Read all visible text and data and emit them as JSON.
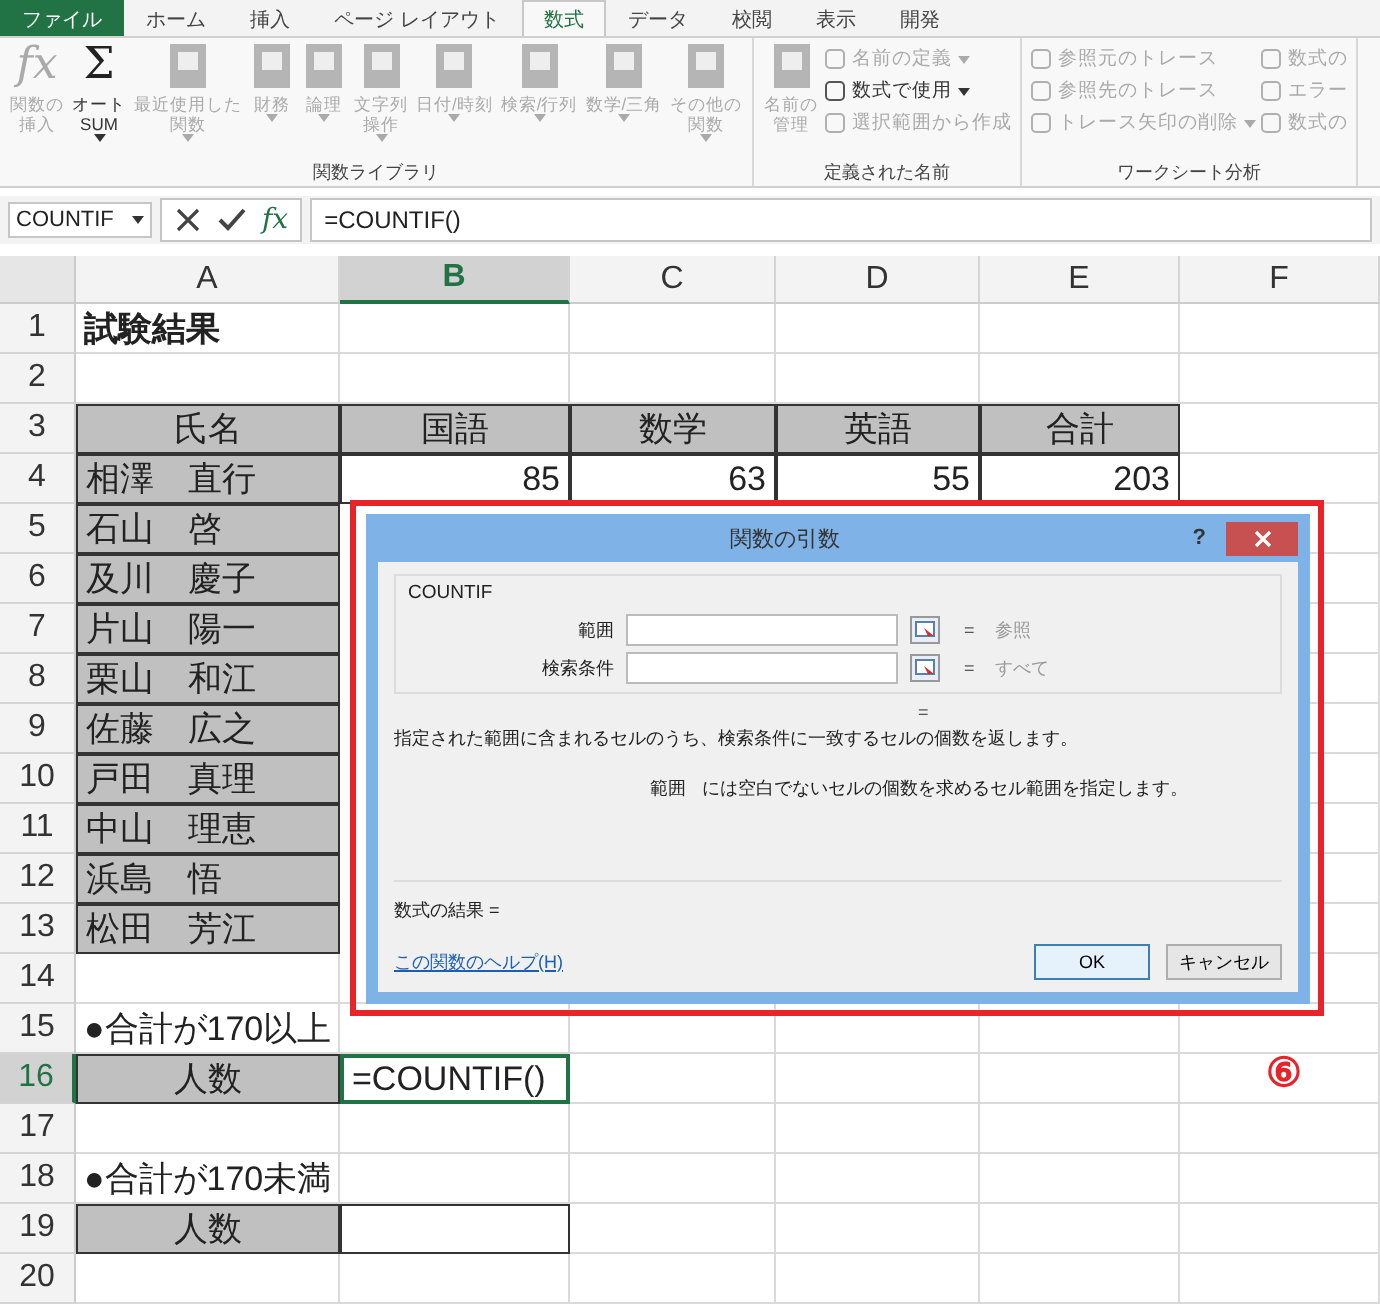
{
  "tabs": [
    {
      "label": "ファイル",
      "kind": "file",
      "selected": false
    },
    {
      "label": "ホーム",
      "kind": "tab",
      "selected": false
    },
    {
      "label": "挿入",
      "kind": "tab",
      "selected": false
    },
    {
      "label": "ページ レイアウト",
      "kind": "tab",
      "selected": false
    },
    {
      "label": "数式",
      "kind": "tab",
      "selected": true
    },
    {
      "label": "データ",
      "kind": "tab",
      "selected": false
    },
    {
      "label": "校閲",
      "kind": "tab",
      "selected": false
    },
    {
      "label": "表示",
      "kind": "tab",
      "selected": false
    },
    {
      "label": "開発",
      "kind": "tab",
      "selected": false
    }
  ],
  "ribbon": [
    {
      "label": "関数ライブラリ",
      "buttons": [
        {
          "lines": [
            "関数の",
            "挿入"
          ],
          "symbol": "fx",
          "disabled": true,
          "dropdown": false
        },
        {
          "lines": [
            "オート",
            "SUM"
          ],
          "symbol": "Σ",
          "disabled": false,
          "dropdown": true
        },
        {
          "lines": [
            "最近使用した",
            "関数"
          ],
          "disabled": true,
          "dropdown": true
        },
        {
          "lines": [
            "財務"
          ],
          "disabled": true,
          "dropdown": true
        },
        {
          "lines": [
            "論理"
          ],
          "disabled": true,
          "dropdown": true
        },
        {
          "lines": [
            "文字列",
            "操作"
          ],
          "disabled": true,
          "dropdown": true
        },
        {
          "lines": [
            "日付/時刻"
          ],
          "disabled": true,
          "dropdown": true
        },
        {
          "lines": [
            "検索/行列"
          ],
          "disabled": true,
          "dropdown": true
        },
        {
          "lines": [
            "数学/三角"
          ],
          "disabled": true,
          "dropdown": true
        },
        {
          "lines": [
            "その他の",
            "関数"
          ],
          "disabled": true,
          "dropdown": true
        }
      ]
    },
    {
      "label": "定義された名前",
      "buttons": [
        {
          "lines": [
            "名前の",
            "管理"
          ],
          "disabled": true,
          "dropdown": false
        }
      ],
      "small": [
        {
          "label": "名前の定義",
          "disabled": true,
          "dropdown": true
        },
        {
          "label": "数式で使用",
          "disabled": false,
          "dropdown": true
        },
        {
          "label": "選択範囲から作成",
          "disabled": true,
          "dropdown": false
        }
      ]
    },
    {
      "label": "ワークシート分析",
      "small": [
        {
          "label": "参照元のトレース",
          "disabled": true,
          "dropdown": false
        },
        {
          "label": "参照先のトレース",
          "disabled": true,
          "dropdown": false
        },
        {
          "label": "トレース矢印の削除",
          "disabled": true,
          "dropdown": true
        }
      ],
      "small2": [
        {
          "label": "数式の",
          "disabled": true
        },
        {
          "label": "エラー",
          "disabled": true
        },
        {
          "label": "数式の",
          "disabled": true
        }
      ]
    }
  ],
  "formula_bar": {
    "name_box": "COUNTIF",
    "fx": "fx",
    "formula": "=COUNTIF()"
  },
  "columns": [
    {
      "label": "A",
      "selected": false
    },
    {
      "label": "B",
      "selected": true
    },
    {
      "label": "C",
      "selected": false
    },
    {
      "label": "D",
      "selected": false
    },
    {
      "label": "E",
      "selected": false
    },
    {
      "label": "F",
      "selected": false
    }
  ],
  "rows": [
    {
      "number": "1",
      "selected": false,
      "cells": [
        {
          "kind": "title",
          "text": "試験結果"
        },
        {},
        {},
        {},
        {},
        {}
      ]
    },
    {
      "number": "2",
      "selected": false,
      "cells": [
        {},
        {},
        {},
        {},
        {},
        {}
      ]
    },
    {
      "number": "3",
      "selected": false,
      "cells": [
        {
          "kind": "header",
          "text": "氏名"
        },
        {
          "kind": "header",
          "text": "国語"
        },
        {
          "kind": "header",
          "text": "数学"
        },
        {
          "kind": "header",
          "text": "英語"
        },
        {
          "kind": "header",
          "text": "合計"
        },
        {}
      ]
    },
    {
      "number": "4",
      "selected": false,
      "cells": [
        {
          "kind": "name",
          "text": "相澤　直行"
        },
        {
          "kind": "number",
          "text": "85"
        },
        {
          "kind": "number",
          "text": "63"
        },
        {
          "kind": "number",
          "text": "55"
        },
        {
          "kind": "number",
          "text": "203"
        },
        {}
      ]
    },
    {
      "number": "5",
      "selected": false,
      "cells": [
        {
          "kind": "name",
          "text": "石山　啓"
        },
        {
          "kind": "number"
        },
        {
          "kind": "number"
        },
        {
          "kind": "number"
        },
        {
          "kind": "number"
        },
        {}
      ]
    },
    {
      "number": "6",
      "selected": false,
      "cells": [
        {
          "kind": "name",
          "text": "及川　慶子"
        },
        {
          "kind": "number"
        },
        {
          "kind": "number"
        },
        {
          "kind": "number"
        },
        {
          "kind": "number"
        },
        {}
      ]
    },
    {
      "number": "7",
      "selected": false,
      "cells": [
        {
          "kind": "name",
          "text": "片山　陽一"
        },
        {
          "kind": "number"
        },
        {
          "kind": "number"
        },
        {
          "kind": "number"
        },
        {
          "kind": "number"
        },
        {}
      ]
    },
    {
      "number": "8",
      "selected": false,
      "cells": [
        {
          "kind": "name",
          "text": "栗山　和江"
        },
        {
          "kind": "number"
        },
        {
          "kind": "number"
        },
        {
          "kind": "number"
        },
        {
          "kind": "number"
        },
        {}
      ]
    },
    {
      "number": "9",
      "selected": false,
      "cells": [
        {
          "kind": "name",
          "text": "佐藤　広之"
        },
        {
          "kind": "number"
        },
        {
          "kind": "number"
        },
        {
          "kind": "number"
        },
        {
          "kind": "number"
        },
        {}
      ]
    },
    {
      "number": "10",
      "selected": false,
      "cells": [
        {
          "kind": "name",
          "text": "戸田　真理"
        },
        {
          "kind": "number"
        },
        {
          "kind": "number"
        },
        {
          "kind": "number"
        },
        {
          "kind": "number"
        },
        {}
      ]
    },
    {
      "number": "11",
      "selected": false,
      "cells": [
        {
          "kind": "name",
          "text": "中山　理恵"
        },
        {
          "kind": "number"
        },
        {
          "kind": "number"
        },
        {
          "kind": "number"
        },
        {
          "kind": "number"
        },
        {}
      ]
    },
    {
      "number": "12",
      "selected": false,
      "cells": [
        {
          "kind": "name",
          "text": "浜島　悟"
        },
        {
          "kind": "number"
        },
        {
          "kind": "number"
        },
        {
          "kind": "number"
        },
        {
          "kind": "number"
        },
        {}
      ]
    },
    {
      "number": "13",
      "selected": false,
      "cells": [
        {
          "kind": "name",
          "text": "松田　芳江"
        },
        {
          "kind": "number"
        },
        {
          "kind": "number"
        },
        {
          "kind": "number"
        },
        {
          "kind": "number"
        },
        {}
      ]
    },
    {
      "number": "14",
      "selected": false,
      "cells": [
        {},
        {},
        {
          "kind": "number"
        },
        {
          "kind": "number"
        },
        {
          "kind": "number"
        },
        {}
      ]
    },
    {
      "number": "15",
      "selected": false,
      "cells": [
        {
          "kind": "text",
          "text": "●合計が170以上"
        },
        {},
        {},
        {},
        {},
        {}
      ]
    },
    {
      "number": "16",
      "selected": true,
      "cells": [
        {
          "kind": "label",
          "text": "人数"
        },
        {
          "kind": "active",
          "text": "=COUNTIF()"
        },
        {},
        {},
        {},
        {}
      ]
    },
    {
      "number": "17",
      "selected": false,
      "cells": [
        {},
        {},
        {},
        {},
        {},
        {}
      ]
    },
    {
      "number": "18",
      "selected": false,
      "cells": [
        {
          "kind": "text",
          "text": "●合計が170未満"
        },
        {},
        {},
        {},
        {},
        {}
      ]
    },
    {
      "number": "19",
      "selected": false,
      "cells": [
        {
          "kind": "label",
          "text": "人数"
        },
        {
          "kind": "boxed"
        },
        {},
        {},
        {},
        {}
      ]
    },
    {
      "number": "20",
      "selected": false,
      "cells": [
        {},
        {},
        {},
        {},
        {},
        {}
      ]
    }
  ],
  "dialog": {
    "title": "関数の引数",
    "help": "?",
    "function": "COUNTIF",
    "arguments": [
      {
        "label": "範囲",
        "equals": "=",
        "hint": "参照"
      },
      {
        "label": "検索条件",
        "equals": "=",
        "hint": "すべて"
      }
    ],
    "result_equals": "=",
    "description": "指定された範囲に含まれるセルのうち、検索条件に一致するセルの個数を返します。",
    "argument_name": "範囲",
    "argument_description": "には空白でないセルの個数を求めるセル範囲を指定します。",
    "result_label": "数式の結果 =",
    "help_link": "この関数のヘルプ(H)",
    "buttons": [
      {
        "label": "OK",
        "selected": true
      },
      {
        "label": "キャンセル",
        "selected": false
      }
    ]
  },
  "step_marker": "⑥"
}
